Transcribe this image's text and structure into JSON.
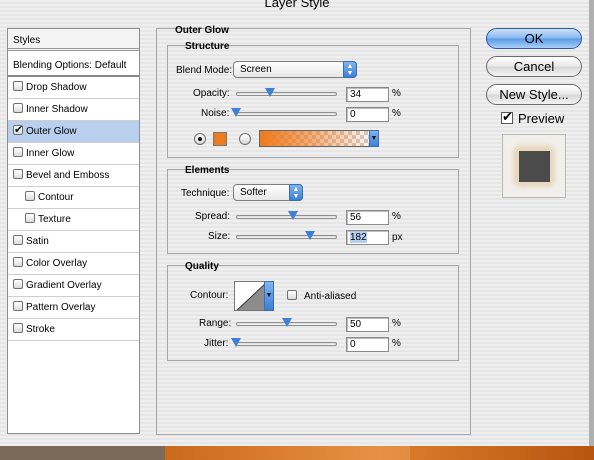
{
  "window": {
    "title": "Layer Style"
  },
  "styles_list": {
    "header": "Styles",
    "blending": "Blending Options: Default",
    "items": [
      {
        "label": "Drop Shadow",
        "checked": false,
        "indent": false
      },
      {
        "label": "Inner Shadow",
        "checked": false,
        "indent": false
      },
      {
        "label": "Outer Glow",
        "checked": true,
        "indent": false,
        "selected": true
      },
      {
        "label": "Inner Glow",
        "checked": false,
        "indent": false
      },
      {
        "label": "Bevel and Emboss",
        "checked": false,
        "indent": false
      },
      {
        "label": "Contour",
        "checked": false,
        "indent": true
      },
      {
        "label": "Texture",
        "checked": false,
        "indent": true
      },
      {
        "label": "Satin",
        "checked": false,
        "indent": false
      },
      {
        "label": "Color Overlay",
        "checked": false,
        "indent": false
      },
      {
        "label": "Gradient Overlay",
        "checked": false,
        "indent": false
      },
      {
        "label": "Pattern Overlay",
        "checked": false,
        "indent": false
      },
      {
        "label": "Stroke",
        "checked": false,
        "indent": false
      }
    ]
  },
  "outer_glow": {
    "title": "Outer Glow",
    "structure": {
      "title": "Structure",
      "blend_mode_label": "Blend Mode:",
      "blend_mode_value": "Screen",
      "opacity_label": "Opacity:",
      "opacity_value": "34",
      "opacity_level": 0.34,
      "noise_label": "Noise:",
      "noise_value": "0",
      "noise_level": 0.0,
      "unit_percent": "%",
      "color_swatch": "#f07a1e",
      "radio_color_selected": true
    },
    "elements": {
      "title": "Elements",
      "technique_label": "Technique:",
      "technique_value": "Softer",
      "spread_label": "Spread:",
      "spread_value": "56",
      "spread_level": 0.56,
      "size_label": "Size:",
      "size_value": "182",
      "size_level": 0.73,
      "unit_percent": "%",
      "unit_px": "px"
    },
    "quality": {
      "title": "Quality",
      "contour_label": "Contour:",
      "anti_aliased_label": "Anti-aliased",
      "anti_aliased_checked": false,
      "range_label": "Range:",
      "range_value": "50",
      "range_level": 0.5,
      "jitter_label": "Jitter:",
      "jitter_value": "0",
      "jitter_level": 0.0,
      "unit_percent": "%"
    }
  },
  "buttons": {
    "ok": "OK",
    "cancel": "Cancel",
    "new_style": "New Style...",
    "preview_label": "Preview",
    "preview_checked": true
  },
  "colors": {
    "accent_blue": "#3f7fd6",
    "selection": "#b8d0ee",
    "glow_color": "#f07a1e"
  }
}
